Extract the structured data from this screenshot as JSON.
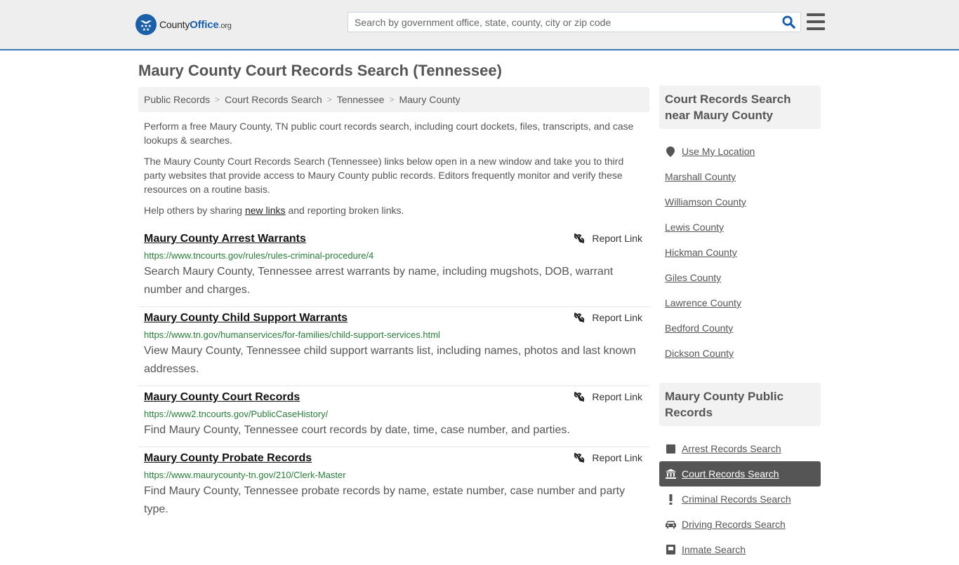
{
  "header": {
    "logo": {
      "prefix": "County",
      "highlight": "Office",
      "suffix": ".org"
    },
    "search_placeholder": "Search by government office, state, county, city or zip code",
    "search_value": "",
    "icons": {
      "search": "search-icon",
      "menu": "hamburger-menu-icon",
      "logo": "eagle-stars-badge-icon"
    },
    "brand_color": "#1b5fa8",
    "accent_border_color": "#3a7bb0"
  },
  "page_title": "Maury County Court Records Search (Tennessee)",
  "breadcrumb": [
    {
      "label": "Public Records"
    },
    {
      "label": "Court Records Search"
    },
    {
      "label": "Tennessee"
    },
    {
      "label": "Maury County"
    }
  ],
  "breadcrumb_separator": ">",
  "intro": {
    "p1": "Perform a free Maury County, TN public court records search, including court dockets, files, transcripts, and case lookups & searches.",
    "p2": "The Maury County Court Records Search (Tennessee) links below open in a new window and take you to third party websites that provide access to Maury County public records. Editors frequently monitor and verify these resources on a routine basis.",
    "p3_before": "Help others by sharing ",
    "p3_link": "new links",
    "p3_after": " and reporting broken links."
  },
  "report_label": "Report Link",
  "results": [
    {
      "title": "Maury County Arrest Warrants",
      "url": "https://www.tncourts.gov/rules/rules-criminal-procedure/4",
      "description": "Search Maury County, Tennessee arrest warrants by name, including mugshots, DOB, warrant number and charges."
    },
    {
      "title": "Maury County Child Support Warrants",
      "url": "https://www.tn.gov/humanservices/for-families/child-support-services.html",
      "description": "View Maury County, Tennessee child support warrants list, including names, photos and last known addresses."
    },
    {
      "title": "Maury County Court Records",
      "url": "https://www2.tncourts.gov/PublicCaseHistory/",
      "description": "Find Maury County, Tennessee court records by date, time, case number, and parties."
    },
    {
      "title": "Maury County Probate Records",
      "url": "https://www.maurycounty-tn.gov/210/Clerk-Master",
      "description": "Find Maury County, Tennessee probate records by name, estate number, case number and party type."
    }
  ],
  "sidebar": {
    "nearby": {
      "heading": "Court Records Search near Maury County",
      "use_location": "Use My Location",
      "counties": [
        "Marshall County",
        "Williamson County",
        "Lewis County",
        "Hickman County",
        "Giles County",
        "Lawrence County",
        "Bedford County",
        "Dickson County"
      ]
    },
    "public_records": {
      "heading": "Maury County Public Records",
      "items": [
        {
          "label": "Arrest Records Search",
          "icon": "square-icon",
          "active": false
        },
        {
          "label": "Court Records Search",
          "icon": "courthouse-icon",
          "active": true
        },
        {
          "label": "Criminal Records Search",
          "icon": "exclamation-icon",
          "active": false
        },
        {
          "label": "Driving Records Search",
          "icon": "car-icon",
          "active": false
        },
        {
          "label": "Inmate Search",
          "icon": "inmate-icon",
          "active": false
        }
      ]
    }
  }
}
